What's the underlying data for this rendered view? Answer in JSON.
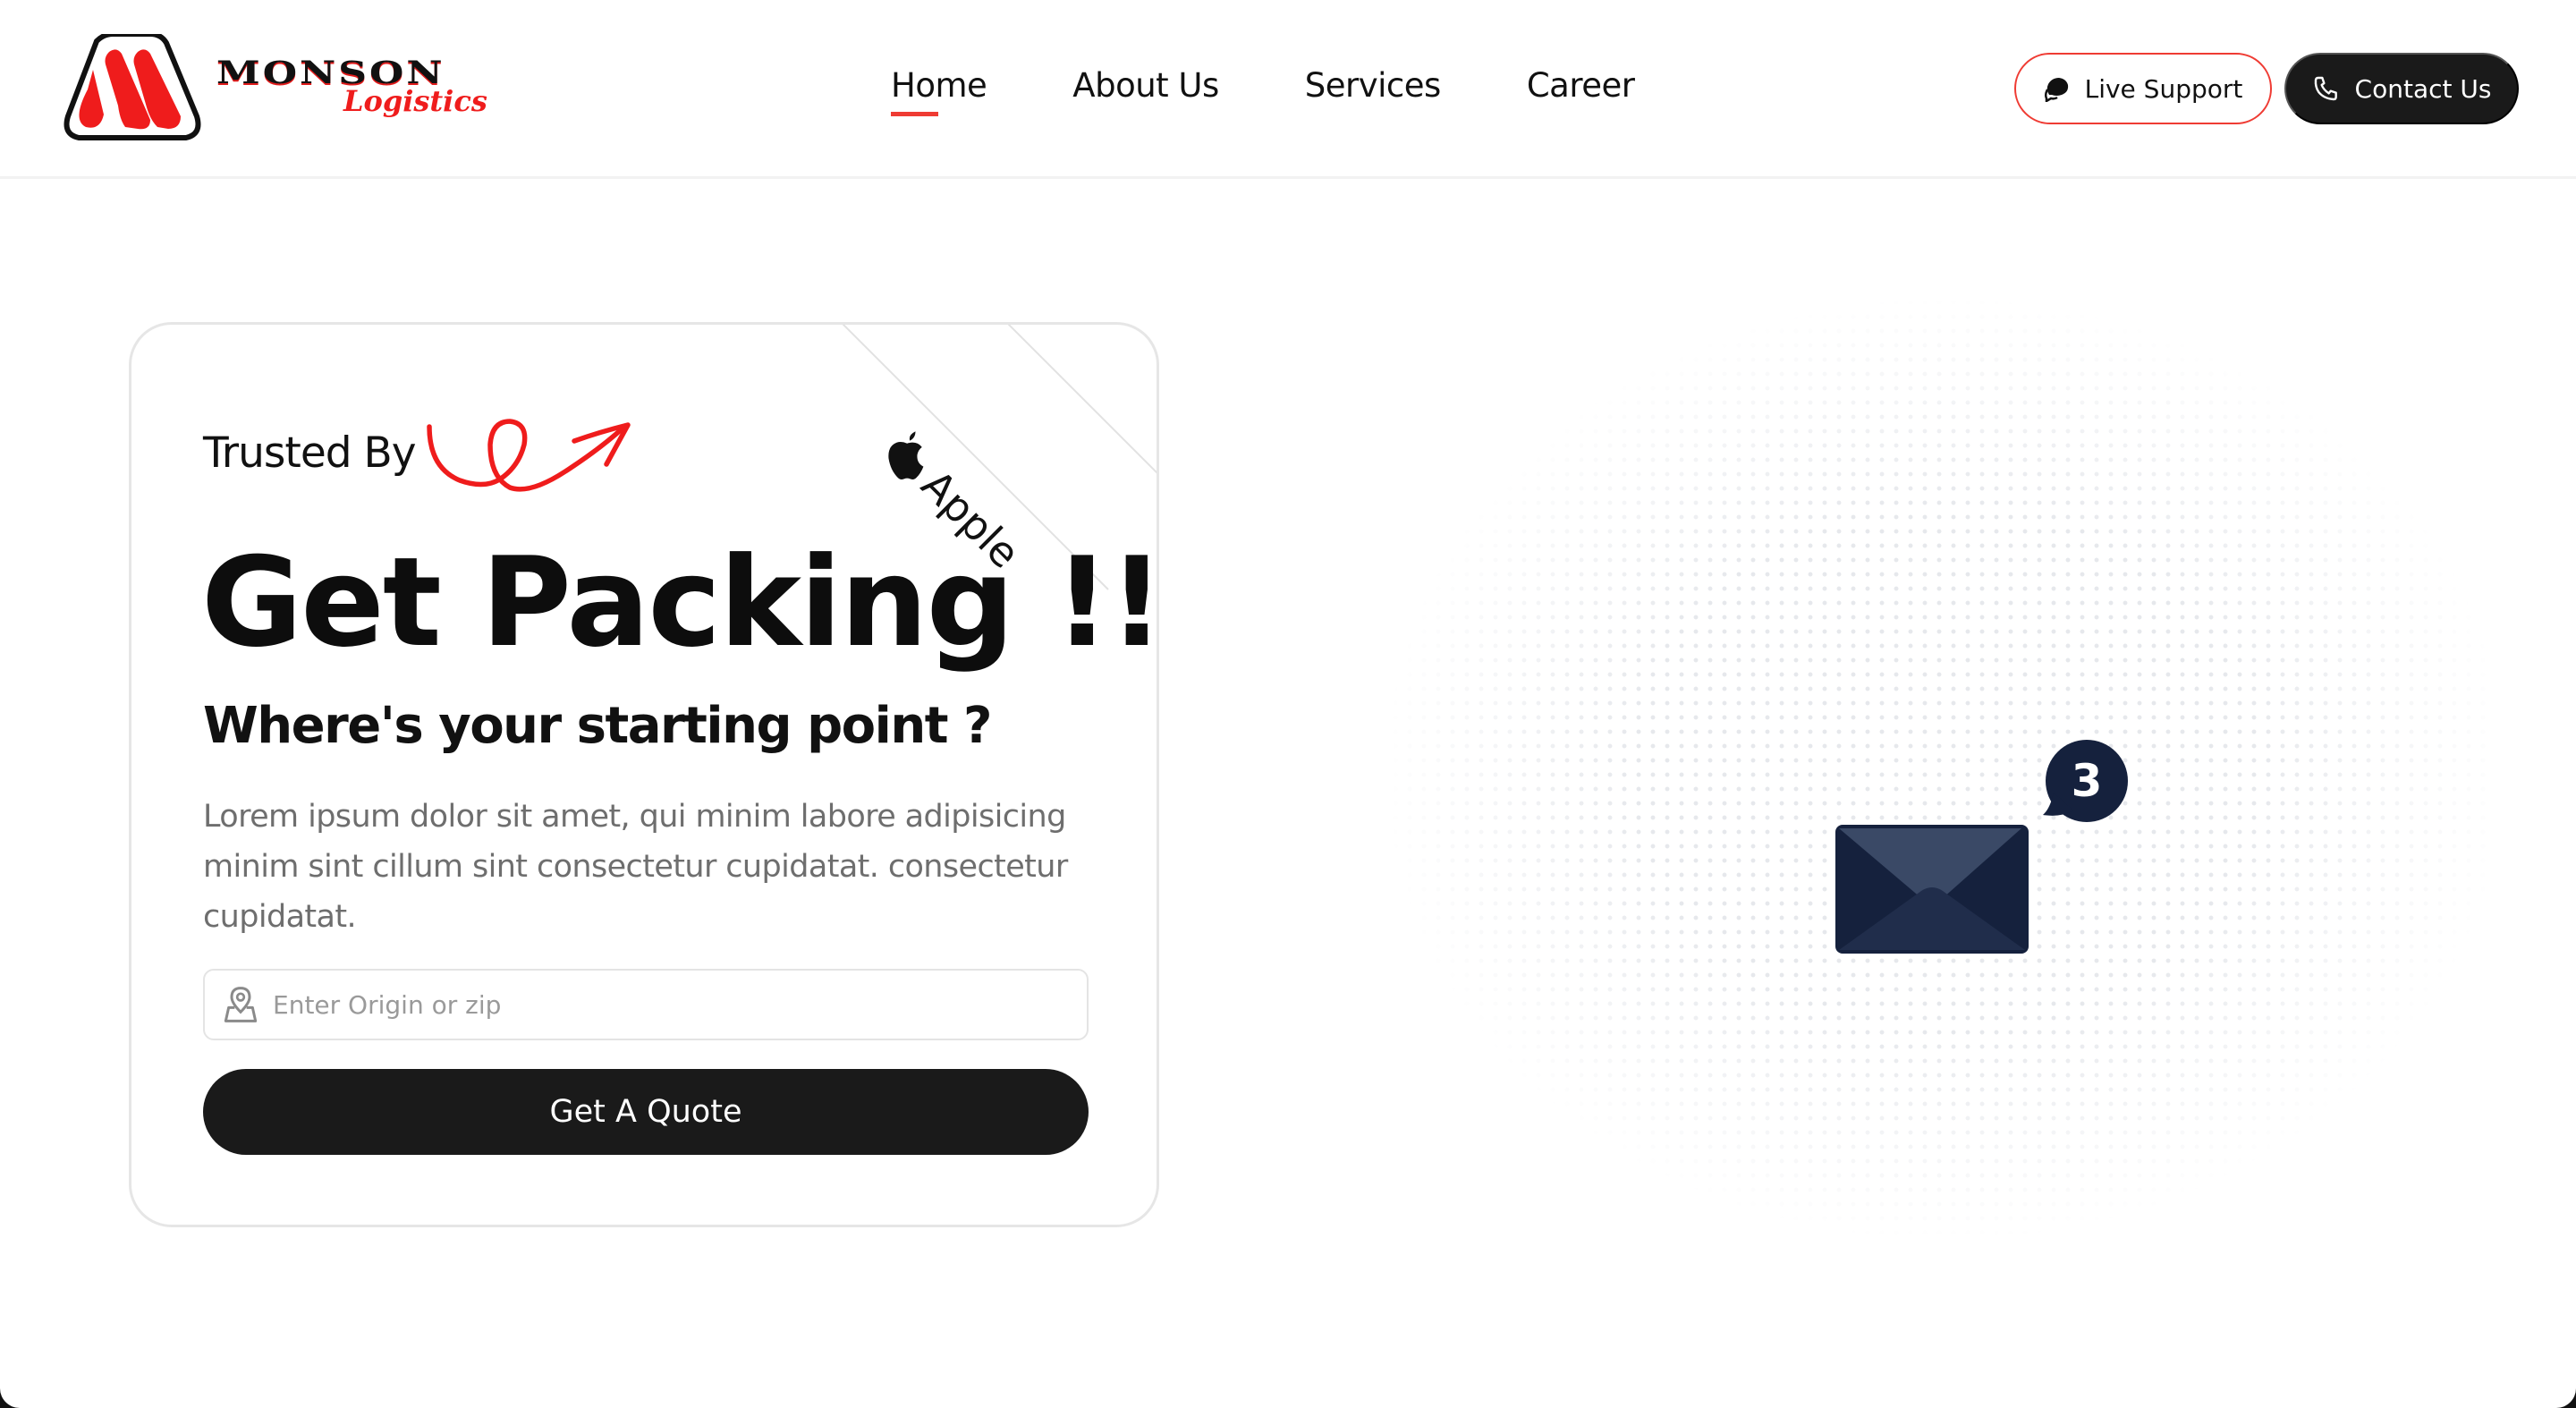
{
  "brand": {
    "name": "MONSON",
    "tagline": "Logistics",
    "colors": {
      "primary_red": "#ef3b33",
      "logo_red": "#ef1c1c",
      "dark": "#1a1a1a",
      "navy": "#15213d"
    }
  },
  "nav": {
    "items": [
      {
        "label": "Home",
        "active": true
      },
      {
        "label": "About Us",
        "active": false
      },
      {
        "label": "Services",
        "active": false
      },
      {
        "label": "Career",
        "active": false
      }
    ]
  },
  "header_actions": {
    "live_support": {
      "label": "Live Support",
      "icon": "chat-bubbles-icon"
    },
    "contact": {
      "label": "Contact Us",
      "icon": "phone-icon"
    }
  },
  "hero": {
    "ribbon": {
      "label": "Apple",
      "icon": "apple-logo-icon"
    },
    "trusted_label": "Trusted By",
    "headline": "Get Packing !!",
    "subheadline": "Where's your starting point ?",
    "description": "Lorem ipsum dolor sit amet, qui minim labore adipisicing minim sint cillum sint consectetur cupidatat. consectetur cupidatat.",
    "origin_input": {
      "value": "",
      "placeholder": "Enter Origin or zip",
      "icon": "map-pin-icon"
    },
    "cta_label": "Get A Quote"
  },
  "illustration": {
    "icon": "envelope-icon",
    "badge_count": "3"
  }
}
